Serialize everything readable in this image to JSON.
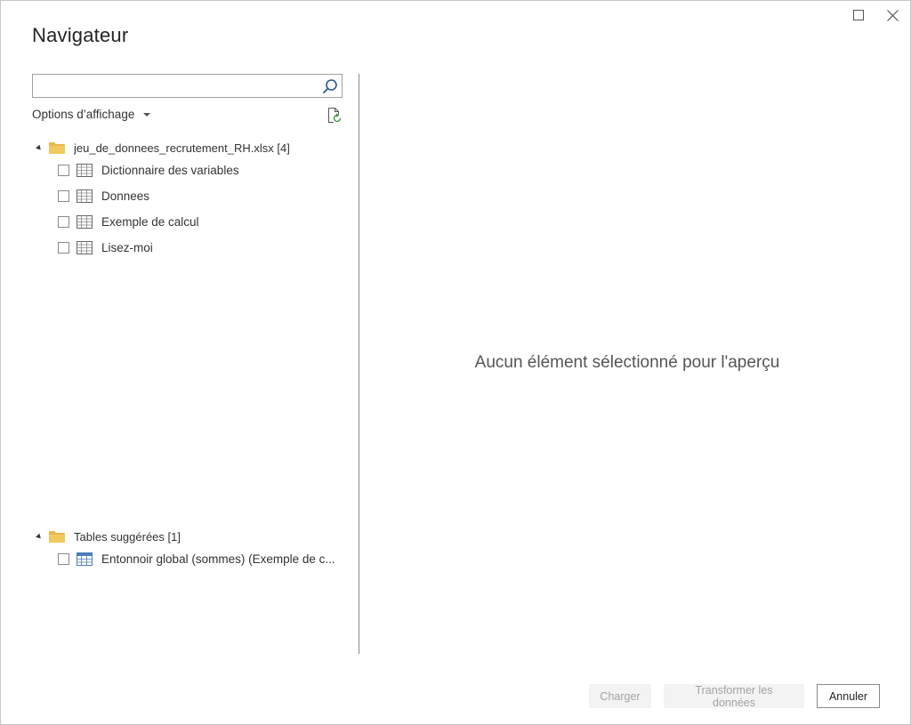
{
  "window": {
    "title": "Navigateur",
    "controls": {
      "maximize_icon": "maximize-icon",
      "close_icon": "close-icon"
    }
  },
  "left_panel": {
    "search": {
      "value": "",
      "placeholder": "",
      "icon": "search-icon"
    },
    "options": {
      "label": "Options d’affichage",
      "refresh_icon": "refresh-icon"
    },
    "tree": {
      "root": {
        "label": "jeu_de_donnees_recrutement_RH.xlsx [4]",
        "icon": "folder-icon",
        "items": [
          {
            "label": "Dictionnaire des variables",
            "icon": "sheet-icon",
            "checked": false
          },
          {
            "label": "Donnees",
            "icon": "sheet-icon",
            "checked": false
          },
          {
            "label": "Exemple de calcul",
            "icon": "sheet-icon",
            "checked": false
          },
          {
            "label": "Lisez-moi",
            "icon": "sheet-icon",
            "checked": false
          }
        ]
      },
      "suggested": {
        "label": "Tables suggérées [1]",
        "icon": "folder-icon",
        "items": [
          {
            "label": "Entonnoir global (sommes) (Exemple de c...",
            "icon": "table-icon",
            "checked": false
          }
        ]
      }
    }
  },
  "preview": {
    "empty_message": "Aucun élément sélectionné pour l'aperçu"
  },
  "footer": {
    "load_label": "Charger",
    "transform_label": "Transformer les données",
    "cancel_label": "Annuler"
  },
  "colors": {
    "folder": "#e8b84a",
    "table_icon": "#4a7ebb",
    "divider": "#8a8a8a",
    "text": "#252423"
  }
}
